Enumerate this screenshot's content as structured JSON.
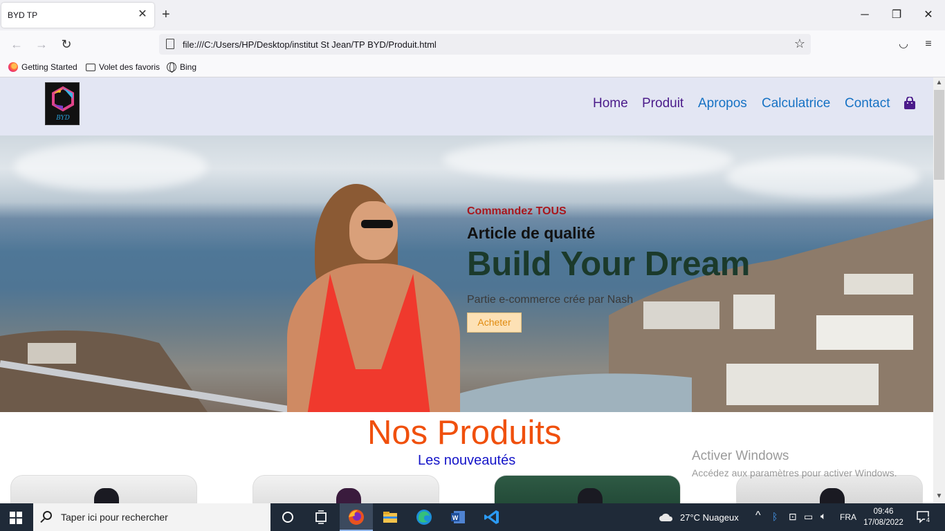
{
  "browser": {
    "tab_title": "BYD TP",
    "url": "file:///C:/Users/HP/Desktop/institut St Jean/TP BYD/Produit.html",
    "bookmarks": [
      {
        "label": "Getting Started",
        "icon": "firefox-icon"
      },
      {
        "label": "Volet des favoris",
        "icon": "folder-icon"
      },
      {
        "label": "Bing",
        "icon": "globe-icon"
      }
    ]
  },
  "site": {
    "logo_text": "BYD",
    "nav": [
      "Home",
      "Produit",
      "Apropos",
      "Calculatrice",
      "Contact"
    ],
    "hero": {
      "kicker": "Commandez TOUS",
      "subtitle": "Article de qualité",
      "title": "Build Your Dream",
      "description": "Partie e-commerce crée par Nash",
      "button": "Acheter"
    },
    "products": {
      "title": "Nos Produits",
      "subtitle": "Les nouveautés"
    }
  },
  "watermark": {
    "line1": "Activer Windows",
    "line2": "Accédez aux paramètres pour activer Windows."
  },
  "taskbar": {
    "search_placeholder": "Taper ici pour rechercher",
    "weather": "27°C  Nuageux",
    "language": "FRA",
    "time": "09:46",
    "date": "17/08/2022",
    "notifications": "4"
  },
  "colors": {
    "nav_visited": "#4b1b8a",
    "nav_link": "#1672c4",
    "hero_kicker": "#a8171d",
    "hero_title": "#1b3a2b",
    "products_title": "#f0500d",
    "products_sub": "#1414c8",
    "button_bg": "#fde1b5"
  }
}
